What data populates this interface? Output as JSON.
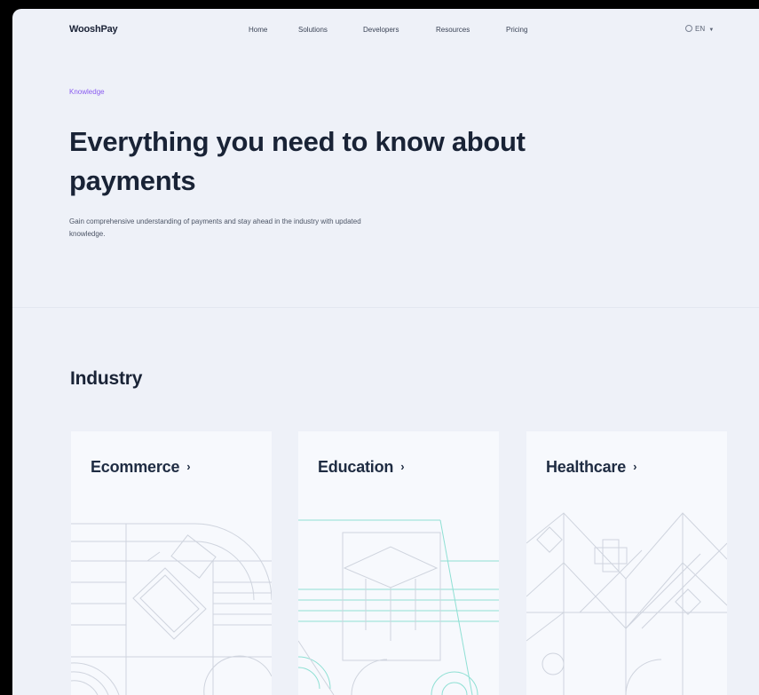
{
  "nav": {
    "logo": "WooshPay",
    "items": [
      {
        "label": "Home"
      },
      {
        "label": "Solutions"
      },
      {
        "label": "Developers"
      },
      {
        "label": "Resources"
      },
      {
        "label": "Pricing"
      }
    ],
    "language": "EN"
  },
  "hero": {
    "eyebrow": "Knowledge",
    "title": "Everything you need to know about payments",
    "subtitle": "Gain comprehensive understanding of payments and stay ahead in the industry with updated knowledge."
  },
  "industry": {
    "heading": "Industry",
    "cards": [
      {
        "label": "Ecommerce",
        "icon": "chevron-right-icon"
      },
      {
        "label": "Education",
        "icon": "chevron-right-icon"
      },
      {
        "label": "Healthcare",
        "icon": "chevron-right-icon"
      }
    ]
  },
  "colors": {
    "page_background": "#eef1f8",
    "eyebrow_accent": "#8a5cf0",
    "heading_text": "#192336",
    "line_art_gray": "#cfd4de",
    "line_art_teal": "#8fe0d4"
  }
}
